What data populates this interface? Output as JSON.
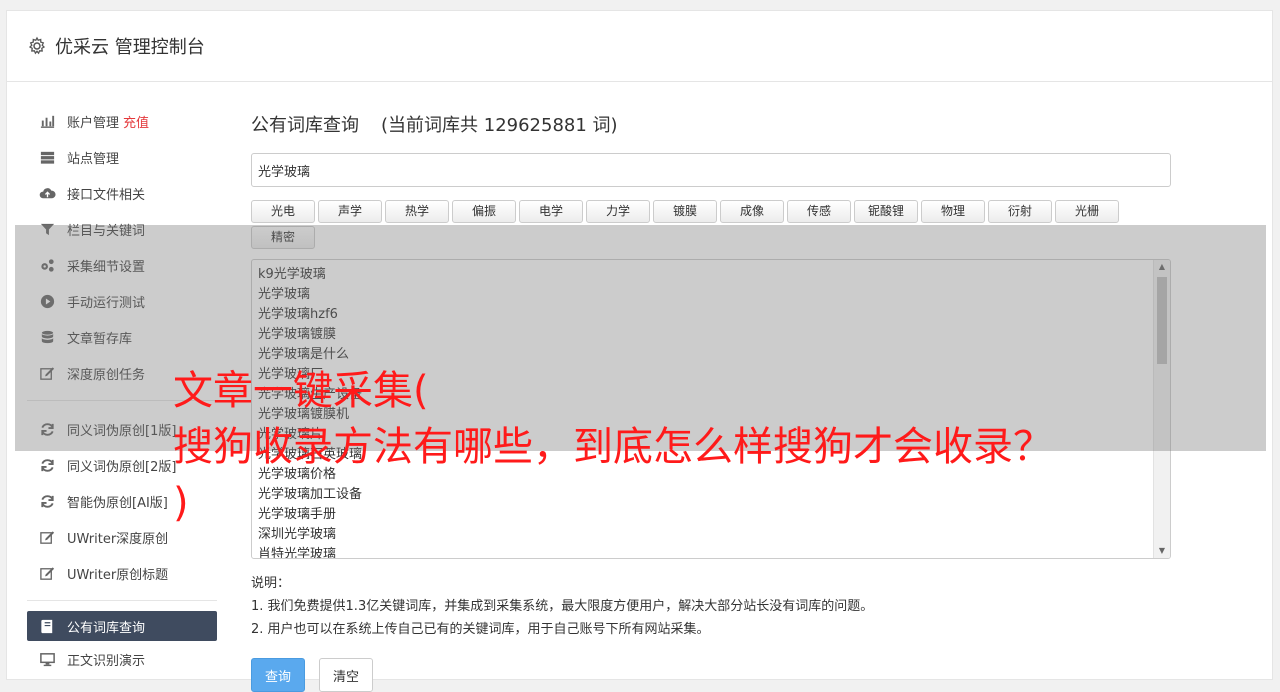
{
  "header": {
    "title": "优采云 管理控制台",
    "icon": "gear-icon"
  },
  "sidebar": {
    "group1": [
      {
        "label": "账户管理",
        "accent": "充值",
        "icon": "bar-chart-icon"
      },
      {
        "label": "站点管理",
        "icon": "server-icon"
      },
      {
        "label": "接口文件相关",
        "icon": "cloud-upload-icon"
      },
      {
        "label": "栏目与关键词",
        "icon": "filter-icon"
      },
      {
        "label": "采集细节设置",
        "icon": "cogs-icon"
      },
      {
        "label": "手动运行测试",
        "icon": "play-circle-icon"
      },
      {
        "label": "文章暂存库",
        "icon": "database-icon"
      },
      {
        "label": "深度原创任务",
        "icon": "edit-icon"
      }
    ],
    "group2": [
      {
        "label": "同义词伪原创[1版]",
        "icon": "refresh-icon"
      },
      {
        "label": "同义词伪原创[2版]",
        "icon": "refresh-icon"
      },
      {
        "label": "智能伪原创[AI版]",
        "icon": "refresh-icon"
      },
      {
        "label": "UWriter深度原创",
        "icon": "edit-icon"
      },
      {
        "label": "UWriter原创标题",
        "icon": "edit-icon"
      }
    ],
    "group3": [
      {
        "label": "公有词库查询",
        "icon": "book-icon",
        "active": true
      },
      {
        "label": "正文识别演示",
        "icon": "desktop-icon"
      }
    ]
  },
  "main": {
    "title": "公有词库查询",
    "count_text": "(当前词库共 129625881 词)",
    "search_value": "光学玻璃",
    "tags": [
      "光电",
      "声学",
      "热学",
      "偏振",
      "电学",
      "力学",
      "镀膜",
      "成像",
      "传感",
      "铌酸锂",
      "物理",
      "衍射",
      "光栅",
      "精密"
    ],
    "results": [
      "k9光学玻璃",
      "光学玻璃",
      "光学玻璃hzf6",
      "光学玻璃镀膜",
      "光学玻璃是什么",
      "光学玻璃厂",
      "光学玻璃生产设备",
      "光学玻璃镀膜机",
      "光学玻璃片",
      "光学玻璃石英玻璃",
      "光学玻璃价格",
      "光学玻璃加工设备",
      "光学玻璃手册",
      "深圳光学玻璃",
      "肖特光学玻璃"
    ],
    "notes_title": "说明：",
    "notes": [
      "1. 我们免费提供1.3亿关键词库，并集成到采集系统，最大限度方便用户，解决大部分站长没有词库的问题。",
      "2. 用户也可以在系统上传自己已有的关键词库，用于自己账号下所有网站采集。"
    ],
    "query_button": "查询",
    "clear_button": "清空"
  },
  "overlay": {
    "line1": "文章一键采集(",
    "line2": "搜狗收录方法有哪些，到底怎么样搜狗才会收录？",
    "line3": ")"
  },
  "colors": {
    "sidebar_active": "#3f4b5f",
    "primary_button": "#5aa9ee",
    "accent": "#e4393c",
    "overlay_text": "#ff1a1a"
  }
}
